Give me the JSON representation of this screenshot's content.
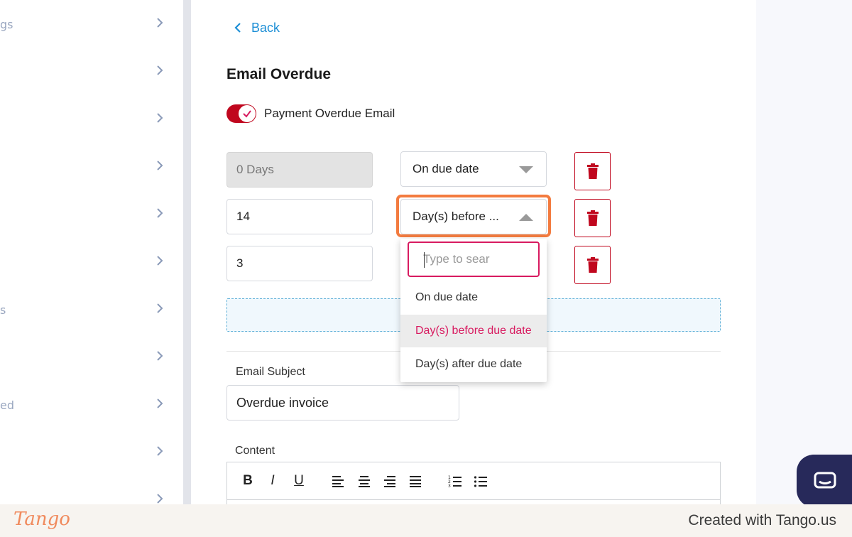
{
  "sidebar": {
    "items": [
      {
        "fragment": "gs"
      },
      {
        "fragment": ""
      },
      {
        "fragment": ""
      },
      {
        "fragment": ""
      },
      {
        "fragment": ""
      },
      {
        "fragment": ""
      },
      {
        "fragment": "s"
      },
      {
        "fragment": ""
      },
      {
        "fragment": "ed"
      },
      {
        "fragment": ""
      },
      {
        "fragment": ""
      }
    ]
  },
  "header": {
    "back_label": "Back",
    "title": "Email Overdue"
  },
  "toggle": {
    "label": "Payment Overdue Email",
    "checked": true
  },
  "reminders": [
    {
      "days": "0 Days",
      "disabled": true,
      "timing": "On due date",
      "open": false
    },
    {
      "days": "14",
      "disabled": false,
      "timing": "Day(s) before ...",
      "open": true
    },
    {
      "days": "3",
      "disabled": false,
      "timing": "",
      "open": false
    }
  ],
  "dropdown": {
    "search_placeholder": "Type to sear",
    "options": [
      {
        "label": "On due date",
        "selected": false
      },
      {
        "label": "Day(s) before due date",
        "selected": true
      },
      {
        "label": "Day(s) after due date",
        "selected": false
      }
    ]
  },
  "email": {
    "subject_label": "Email Subject",
    "subject_value": "Overdue invoice",
    "content_label": "Content"
  },
  "editor_toolbar": {
    "bold": "B",
    "italic": "I",
    "underline": "U"
  },
  "footer": {
    "logo_text": "Tango",
    "created_text": "Created with Tango.us"
  },
  "colors": {
    "accent_red": "#c0071e",
    "link_blue": "#1d8fd6",
    "highlight_orange": "#f37b3f",
    "selected_pink": "#d81b60"
  }
}
